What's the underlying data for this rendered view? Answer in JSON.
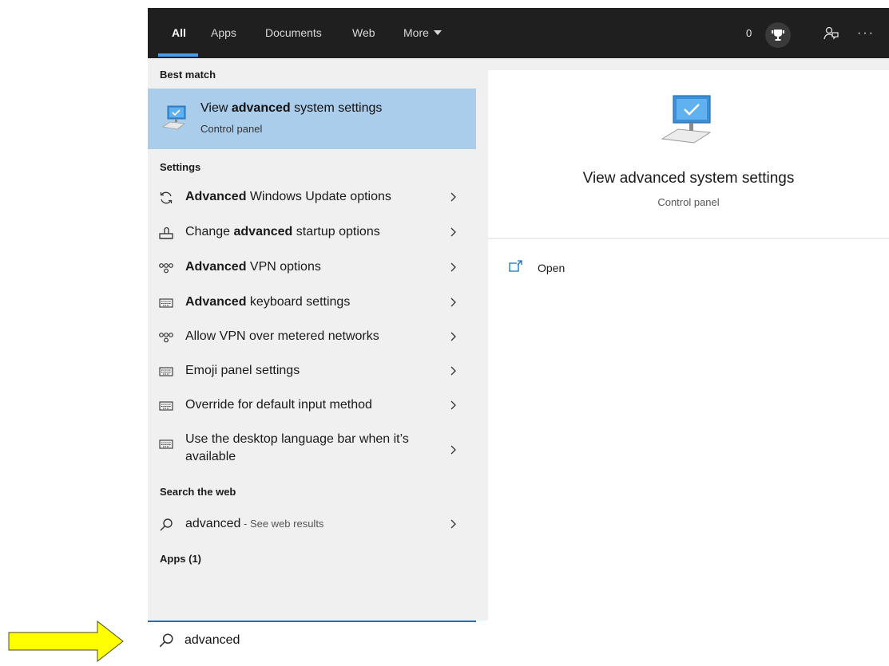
{
  "tabs": [
    {
      "label": "All"
    },
    {
      "label": "Apps"
    },
    {
      "label": "Documents"
    },
    {
      "label": "Web"
    },
    {
      "label": "More"
    }
  ],
  "header": {
    "points": "0"
  },
  "sections": {
    "best_match": "Best match",
    "settings": "Settings",
    "search_web": "Search the web",
    "apps": "Apps (1)"
  },
  "best_match": {
    "title_pre": "View ",
    "title_bold": "advanced",
    "title_post": " system settings",
    "subtitle": "Control panel",
    "icon": "computer-monitor-icon"
  },
  "settings_items": [
    {
      "bold": "Advanced",
      "text": " Windows Update options",
      "icon": "refresh-icon"
    },
    {
      "pre": "Change ",
      "bold": "advanced",
      "text": " startup options",
      "icon": "startup-icon"
    },
    {
      "bold": "Advanced",
      "text": " VPN options",
      "icon": "vpn-icon"
    },
    {
      "bold": "Advanced",
      "text": " keyboard settings",
      "icon": "keyboard-icon"
    },
    {
      "text": "Allow VPN over metered networks",
      "icon": "vpn-icon"
    },
    {
      "text": "Emoji panel settings",
      "icon": "keyboard-icon"
    },
    {
      "text": "Override for default input method",
      "icon": "keyboard-icon"
    },
    {
      "text": "Use the desktop language bar when it’s available",
      "icon": "keyboard-icon"
    }
  ],
  "web_result": {
    "query": "advanced",
    "suffix": " - See web results"
  },
  "preview": {
    "title": "View advanced system settings",
    "subtitle": "Control panel",
    "open_label": "Open"
  },
  "search": {
    "value": "advanced"
  },
  "colors": {
    "accent": "#0a70c6",
    "highlight": "#a9cdea",
    "topbar": "#1f1f1f",
    "arrow": "#ffff00"
  }
}
